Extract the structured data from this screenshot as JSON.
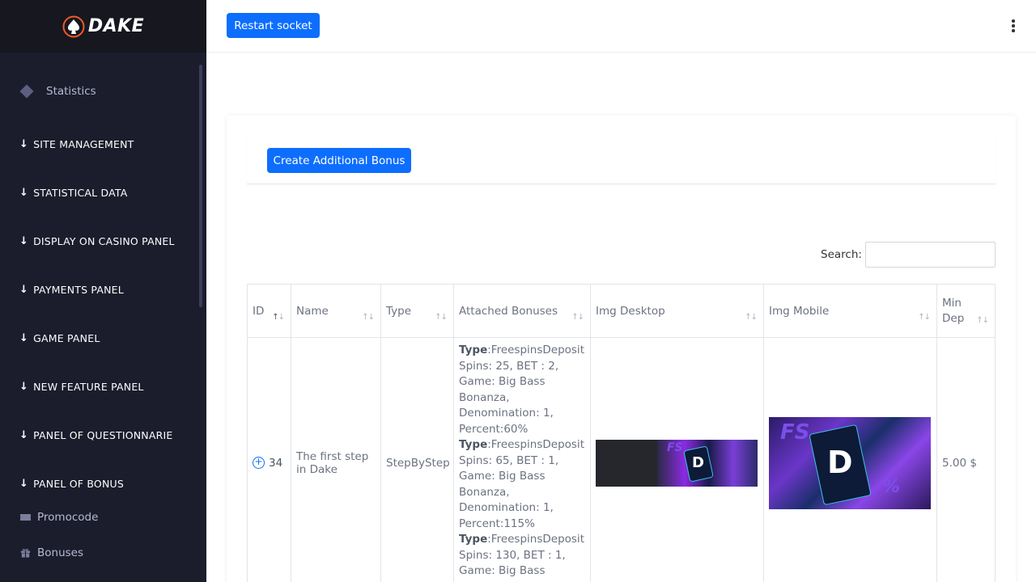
{
  "brand": {
    "name": "DAKE"
  },
  "sidebar": {
    "statistics": "Statistics",
    "sections": [
      "SITE MANAGEMENT",
      "STATISTICAL DATA",
      "DISPLAY ON CASINO PANEL",
      "PAYMENTS PANEL",
      "GAME PANEL",
      "NEW FEATURE PANEL",
      "PANEL OF QUESTIONNARIE",
      "PANEL OF BONUS"
    ],
    "sub_items": [
      "Promocode",
      "Bonuses"
    ]
  },
  "topbar": {
    "restart_label": "Restart socket"
  },
  "main": {
    "create_label": "Create Additional Bonus",
    "search_label": "Search:",
    "search_value": "",
    "columns": [
      "ID",
      "Name",
      "Type",
      "Attached Bonuses",
      "Img Desktop",
      "Img Mobile",
      "Min Dep"
    ],
    "rows": [
      {
        "id": "34",
        "name": "The first step in Dake",
        "type": "StepByStep",
        "bonuses": [
          {
            "type_label": "Type",
            "type": ":FreespinsDeposit",
            "details": "Spins: 25, BET : 2, Game: Big Bass Bonanza, Denomination: 1, Percent:60%"
          },
          {
            "type_label": "Type",
            "type": ":FreespinsDeposit",
            "details": "Spins: 65, BET : 1, Game: Big Bass Bonanza, Denomination: 1, Percent:115%"
          },
          {
            "type_label": "Type",
            "type": ":FreespinsDeposit",
            "details": "Spins: 130, BET : 1, Game: Big Bass"
          }
        ],
        "min_dep": "5.00 $"
      }
    ]
  },
  "colors": {
    "accent": "#0d6efd",
    "sidebar_bg": "#1c1d2c"
  },
  "icons": {
    "statistics": "diamond-icon",
    "section": "arrow-down-icon",
    "promocode": "ticket-icon",
    "bonuses": "gift-icon",
    "expand": "plus-circle-icon",
    "menu": "kebab-menu-icon"
  }
}
